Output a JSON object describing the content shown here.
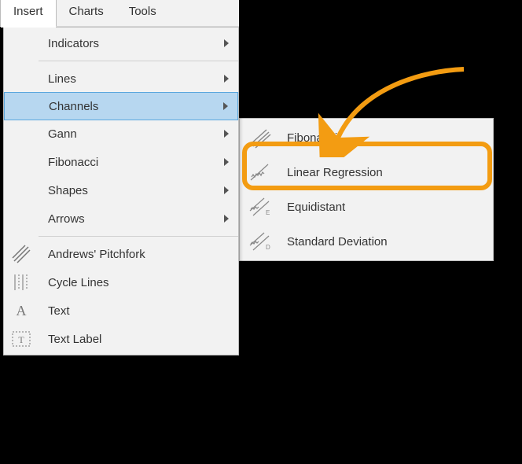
{
  "menubar": {
    "insert": "Insert",
    "charts": "Charts",
    "tools": "Tools"
  },
  "dropdown": {
    "indicators": "Indicators",
    "lines": "Lines",
    "channels": "Channels",
    "gann": "Gann",
    "fibonacci": "Fibonacci",
    "shapes": "Shapes",
    "arrows": "Arrows",
    "andrews_pitchfork": "Andrews' Pitchfork",
    "cycle_lines": "Cycle Lines",
    "text": "Text",
    "text_label": "Text Label"
  },
  "submenu": {
    "fibonacci": "Fibonacci",
    "linear_regression": "Linear Regression",
    "equidistant": "Equidistant",
    "standard_deviation": "Standard Deviation"
  },
  "icons": {
    "letter_A": "A",
    "sub_E": "E",
    "sub_D": "D"
  },
  "colors": {
    "highlight_bg": "#b7d7f0",
    "highlight_border": "#5aa7dd",
    "annotation": "#f39c12",
    "menu_bg": "#f2f2f2",
    "border": "#bcbcbc"
  }
}
